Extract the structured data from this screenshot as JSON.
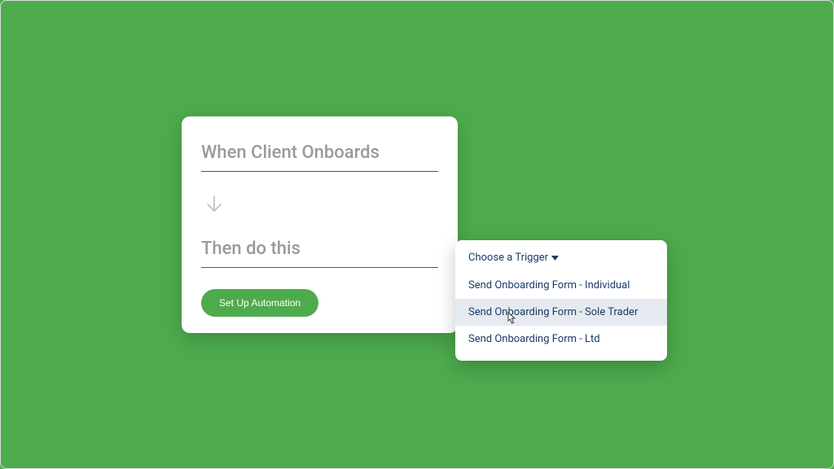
{
  "card": {
    "trigger_label": "When Client Onboards",
    "action_label": "Then do this",
    "setup_button": "Set Up Automation"
  },
  "dropdown": {
    "header": "Choose a Trigger",
    "items": [
      {
        "label": "Send Onboarding Form - Individual",
        "highlighted": false
      },
      {
        "label": "Send Onboarding Form - Sole Trader",
        "highlighted": true
      },
      {
        "label": "Send Onboarding Form - Ltd",
        "highlighted": false
      }
    ]
  },
  "colors": {
    "background": "#4DAB4D",
    "button": "#4DAB4D",
    "text_muted": "#9a9a9a",
    "dropdown_text": "#1a3b66",
    "highlight": "#e5eaf0"
  }
}
